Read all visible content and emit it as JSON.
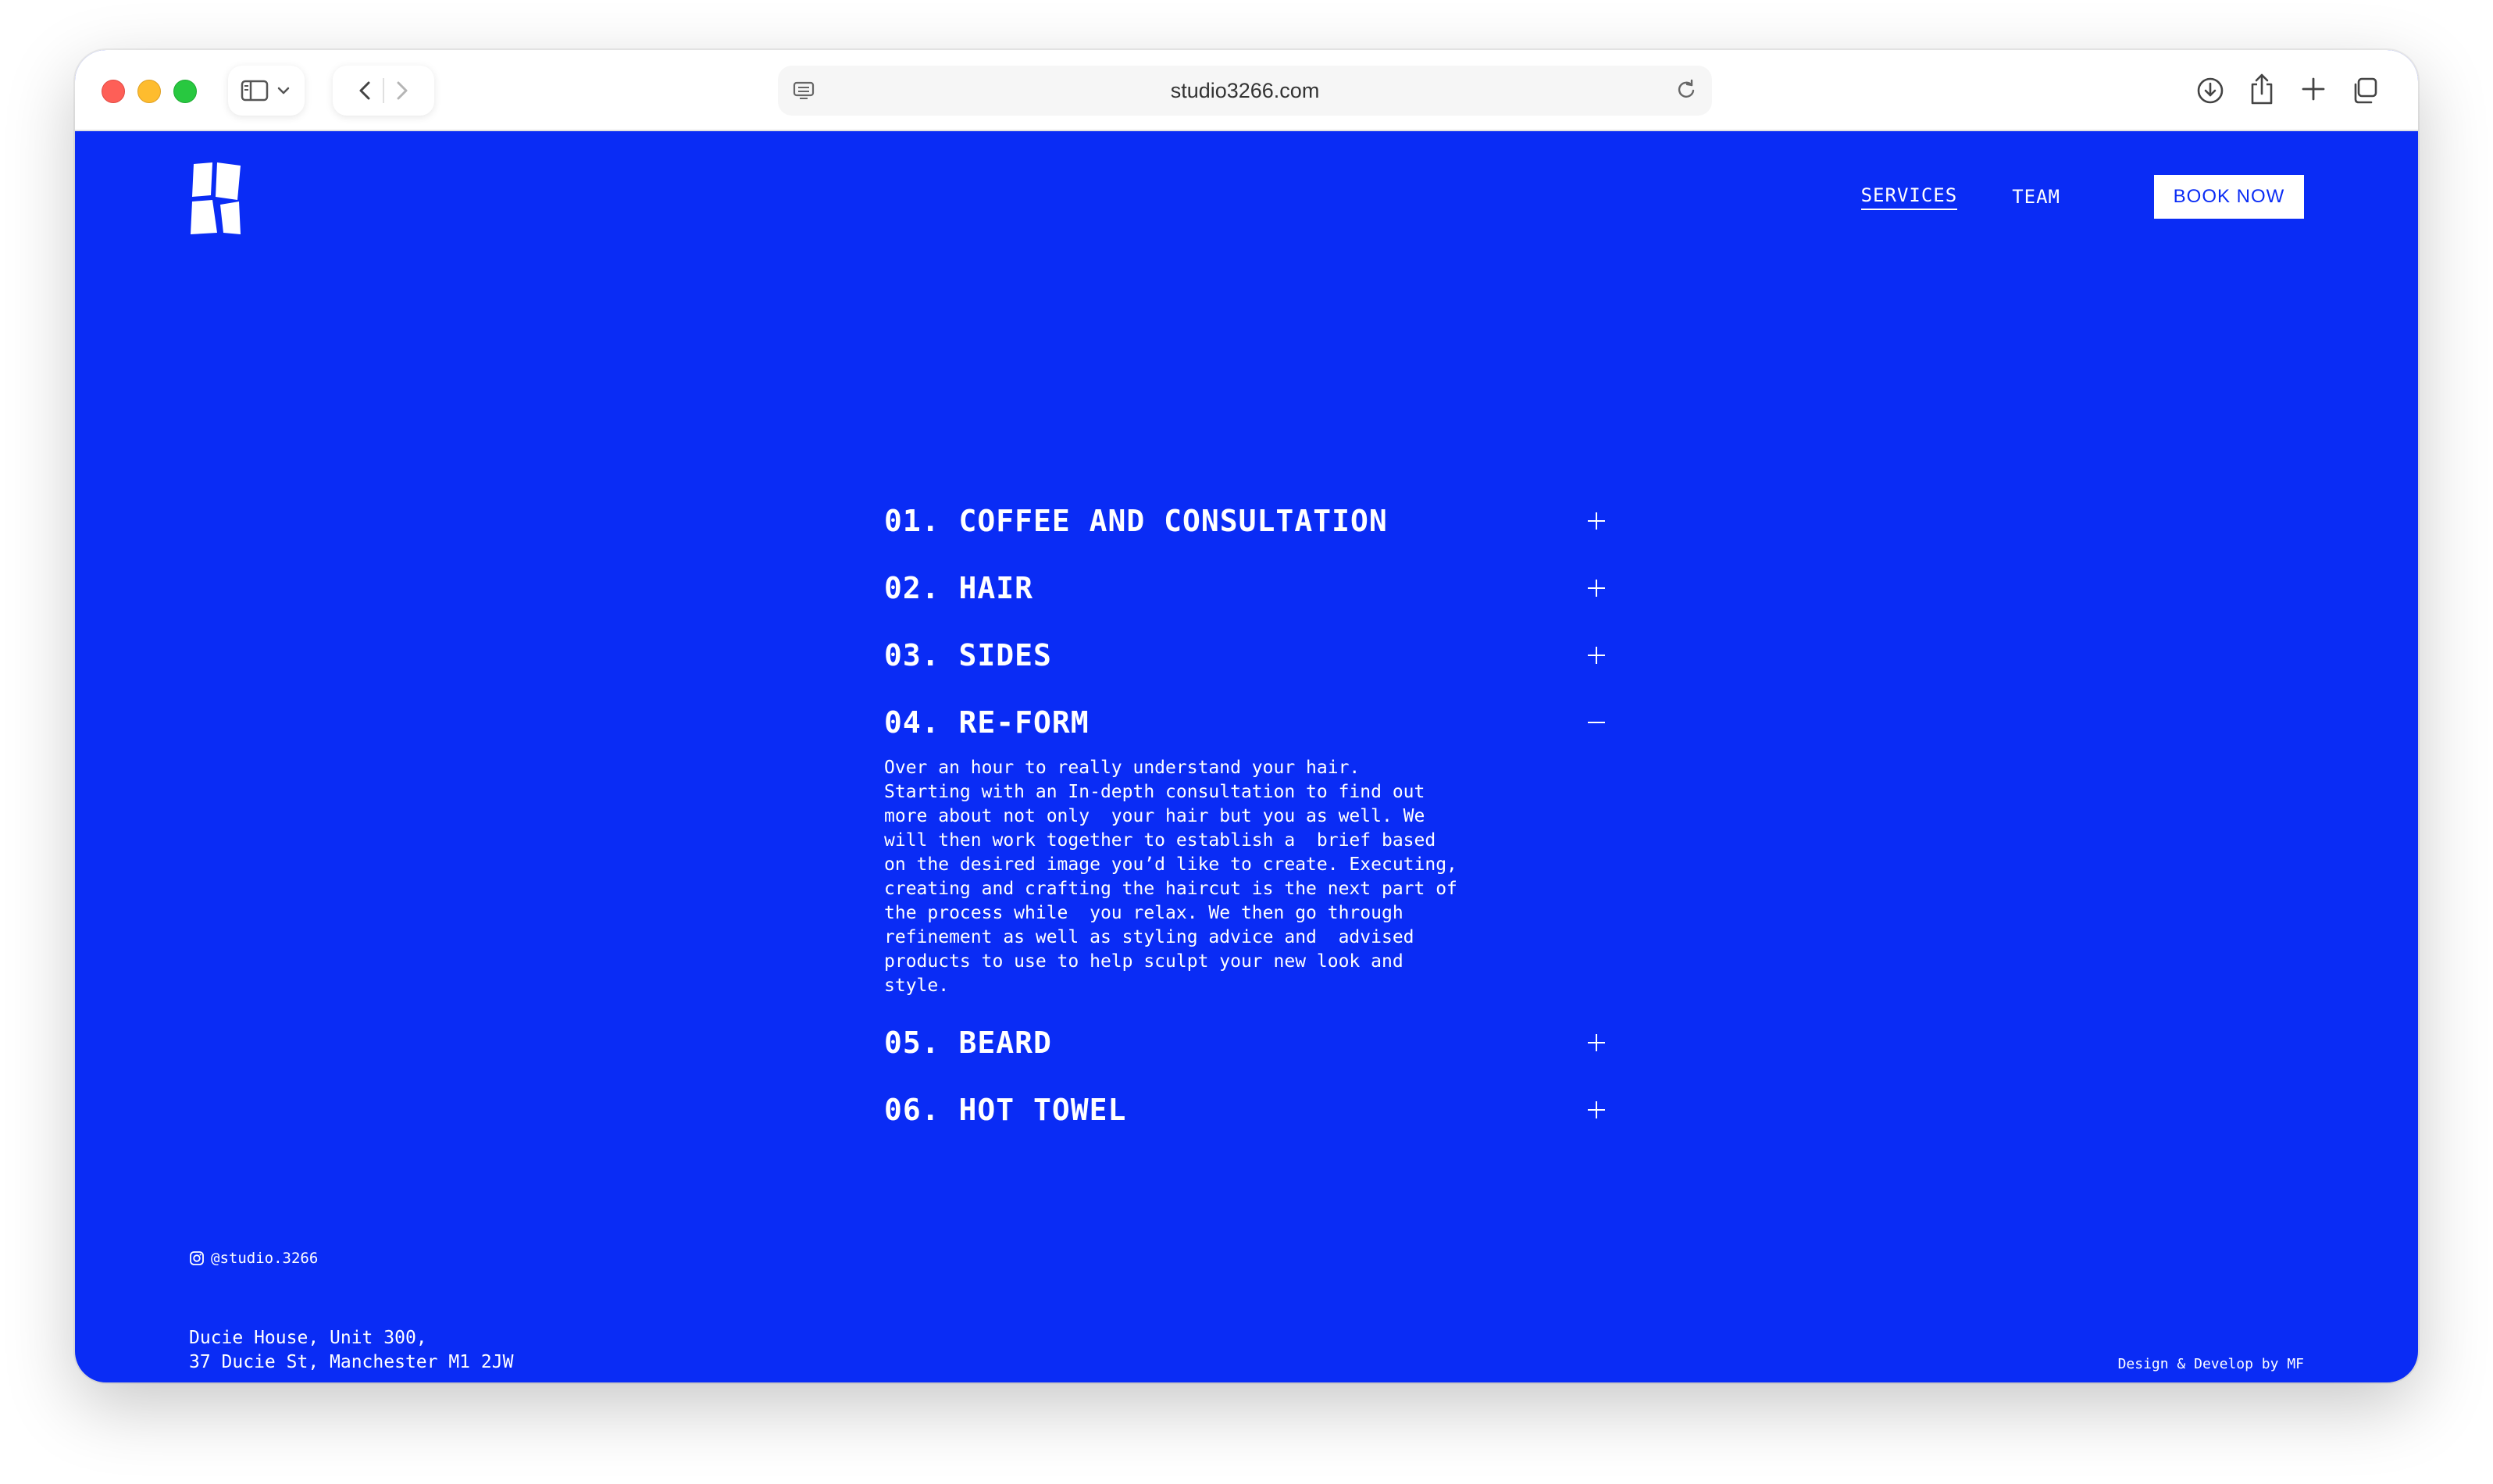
{
  "browser": {
    "url": "studio3266.com",
    "traffic_colors": {
      "close": "#fe5f57",
      "minimize": "#febc2e",
      "zoom": "#28c840"
    },
    "icons": [
      "sidebar-icon",
      "chevron-down-icon",
      "back-icon",
      "forward-icon",
      "page-info-icon",
      "reload-icon",
      "download-icon",
      "share-icon",
      "new-tab-icon",
      "tabs-overview-icon"
    ]
  },
  "site": {
    "accent": "#0a2cf5",
    "logo": "studio-3266-logo",
    "nav": {
      "services": "SERVICES",
      "team": "TEAM",
      "book_now": "BOOK NOW"
    },
    "services": [
      {
        "title": "01. COFFEE AND CONSULTATION",
        "expanded": false,
        "toggle": "plus-icon"
      },
      {
        "title": "02. HAIR",
        "expanded": false,
        "toggle": "plus-icon"
      },
      {
        "title": "03. SIDES",
        "expanded": false,
        "toggle": "plus-icon"
      },
      {
        "title": "04. RE-FORM",
        "expanded": true,
        "toggle": "minus-icon",
        "description": "Over an hour to really understand your hair.\nStarting with an In-depth consultation to find out\nmore about not only  your hair but you as well. We\nwill then work together to establish a  brief based\non the desired image you’d like to create. Executing,\ncreating and crafting the haircut is the next part of\nthe process while  you relax. We then go through\nrefinement as well as styling advice and  advised\nproducts to use to help sculpt your new look and\nstyle."
      },
      {
        "title": "05. BEARD",
        "expanded": false,
        "toggle": "plus-icon"
      },
      {
        "title": "06. HOT TOWEL",
        "expanded": false,
        "toggle": "plus-icon"
      }
    ],
    "footer": {
      "instagram": "@studio.3266",
      "address_line1": "Ducie House, Unit 300,",
      "address_line2": "37 Ducie St, Manchester M1 2JW",
      "credit": "Design & Develop by MF"
    }
  }
}
